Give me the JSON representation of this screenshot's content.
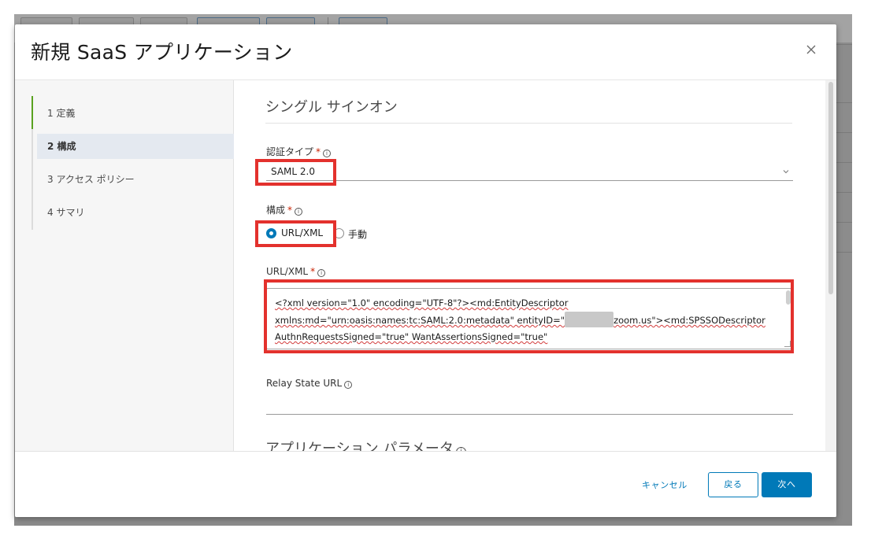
{
  "modal": {
    "title": "新規 SaaS アプリケーション",
    "steps": [
      {
        "label": "1 定義"
      },
      {
        "label": "2 構成"
      },
      {
        "label": "3 アクセス ポリシー"
      },
      {
        "label": "4 サマリ"
      }
    ],
    "section_title": "シングル サインオン",
    "auth_type": {
      "label": "認証タイプ",
      "required_mark": "*",
      "value": "SAML 2.0"
    },
    "config": {
      "label": "構成",
      "required_mark": "*",
      "options": [
        {
          "label": "URL/XML",
          "checked": true
        },
        {
          "label": "手動",
          "checked": false
        }
      ]
    },
    "url_xml": {
      "label": "URL/XML",
      "required_mark": "*",
      "line1": "<?xml version=\"1.0\" encoding=\"UTF-8\"?><md:EntityDescriptor",
      "line2_a": "xmlns:md=\"urn:oasis:names:tc:SAML:2.0:metadata\" entityID=\"",
      "line2_b": "zoom.us\"><md:SPSSODescriptor",
      "line3": "AuthnRequestsSigned=\"true\" WantAssertionsSigned=\"true\""
    },
    "relay_state": {
      "label": "Relay State URL",
      "value": ""
    },
    "app_params_title": "アプリケーション パラメータ",
    "footer": {
      "cancel": "キャンセル",
      "back": "戻る",
      "next": "次へ"
    }
  },
  "colors": {
    "accent": "#0079b8",
    "highlight": "#e3312d",
    "step_done": "#5aa220"
  }
}
